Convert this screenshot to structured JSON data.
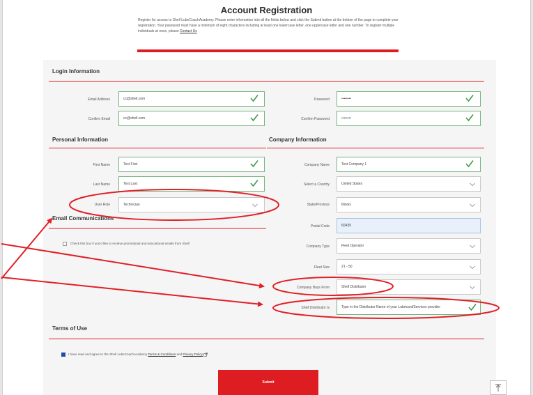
{
  "header": {
    "title": "Account Registration",
    "intro": "Register for access to Shell LubeCoachAcademy. Please enter information into all the fields below and click the Submit button at the bottom of the page to complete your registration. Your password must have a minimum of eight characters including at least one lowercase letter, one uppercase letter and one number. To register multiple individuals at once, please",
    "contact_link": "Contact Us"
  },
  "login": {
    "section": "Login Information",
    "email_label": "Email Address",
    "email_value": "cc@shell.com",
    "confirm_email_label": "Confirm Email",
    "confirm_email_value": "cc@shell.com",
    "password_label": "Password",
    "password_value": "••••••••",
    "confirm_password_label": "Confirm Password",
    "confirm_password_value": "••••••••"
  },
  "personal": {
    "section": "Personal Information",
    "first_name_label": "First Name",
    "first_name_value": "Test First",
    "last_name_label": "Last Name",
    "last_name_value": "Test Last",
    "user_role_label": "User Role",
    "user_role_value": "Technician"
  },
  "email_comms": {
    "section": "Email Communications",
    "opt_in_text": "Check this box if you'd like to receive promotional and educational emails from Shell"
  },
  "company": {
    "section": "Company Information",
    "company_name_label": "Company Name",
    "company_name_value": "Test Company 1",
    "country_label": "Select a Country",
    "country_value": "United States",
    "state_label": "State/Province",
    "state_value": "Illinois",
    "postal_label": "Postal Code",
    "postal_value": "60439",
    "company_type_label": "Company Type",
    "company_type_value": "Fleet Operator",
    "fleet_size_label": "Fleet Size",
    "fleet_size_value": "21 - 50",
    "buys_from_label": "Company Buys From",
    "buys_from_value": "Shell Distributor",
    "distributor_label": "Shell Distributor Is",
    "distributor_value": "Type in the Distributor Name of your Lubricant/Services provider"
  },
  "terms": {
    "section": "Terms of Use",
    "agree_prefix": "I have read and agree to the Shell LubeCoachAcademy",
    "terms_link": "Terms & Conditions",
    "and_text": "and",
    "privacy_link": "Privacy Policy",
    "submit_label": "Submit"
  },
  "colors": {
    "accent_red": "#dd1d21",
    "valid_green": "#3d9a4a",
    "annotation_red": "#e01f26",
    "checkbox_blue": "#1c4fa1"
  },
  "icons": {
    "valid": "check-icon",
    "dropdown": "chevron-down-icon",
    "back_to_top": "arrow-up-icon",
    "external": "external-link-icon"
  }
}
